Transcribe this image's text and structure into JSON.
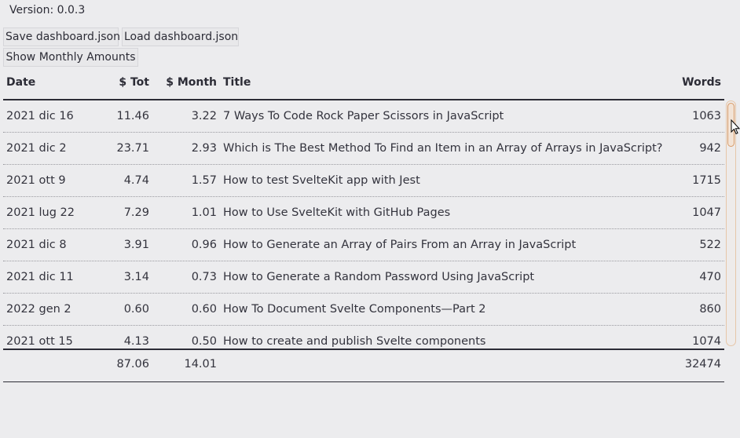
{
  "version_text": "Version: 0.0.3",
  "toolbar": {
    "save_label": "Save dashboard.json",
    "load_label": "Load dashboard.json",
    "monthly_label": "Show Monthly Amounts"
  },
  "table": {
    "headers": {
      "date": "Date",
      "tot": "$ Tot",
      "month": "$ Month",
      "title": "Title",
      "words": "Words"
    },
    "rows": [
      {
        "date": "2021 dic 16",
        "tot": "11.46",
        "month": "3.22",
        "title": "7 Ways To Code Rock Paper Scissors in JavaScript",
        "words": "1063"
      },
      {
        "date": "2021 dic 2",
        "tot": "23.71",
        "month": "2.93",
        "title": "Which is The Best Method To Find an Item in an Array of Arrays in JavaScript?",
        "words": "942"
      },
      {
        "date": "2021 ott 9",
        "tot": "4.74",
        "month": "1.57",
        "title": "How to test SvelteKit app with Jest",
        "words": "1715"
      },
      {
        "date": "2021 lug 22",
        "tot": "7.29",
        "month": "1.01",
        "title": "How to Use SvelteKit with GitHub Pages",
        "words": "1047"
      },
      {
        "date": "2021 dic 8",
        "tot": "3.91",
        "month": "0.96",
        "title": "How to Generate an Array of Pairs From an Array in JavaScript",
        "words": "522"
      },
      {
        "date": "2021 dic 11",
        "tot": "3.14",
        "month": "0.73",
        "title": "How to Generate a Random Password Using JavaScript",
        "words": "470"
      },
      {
        "date": "2022 gen 2",
        "tot": "0.60",
        "month": "0.60",
        "title": "How To Document Svelte Components—Part 2",
        "words": "860"
      },
      {
        "date": "2021 ott 15",
        "tot": "4.13",
        "month": "0.50",
        "title": "How to create and publish Svelte components",
        "words": "1074"
      }
    ],
    "totals": {
      "tot": "87.06",
      "month": "14.01",
      "words": "32474"
    }
  },
  "colors": {
    "background": "#ececee",
    "text": "#2c2c36",
    "scrollbar_accent": "#d99a66"
  }
}
